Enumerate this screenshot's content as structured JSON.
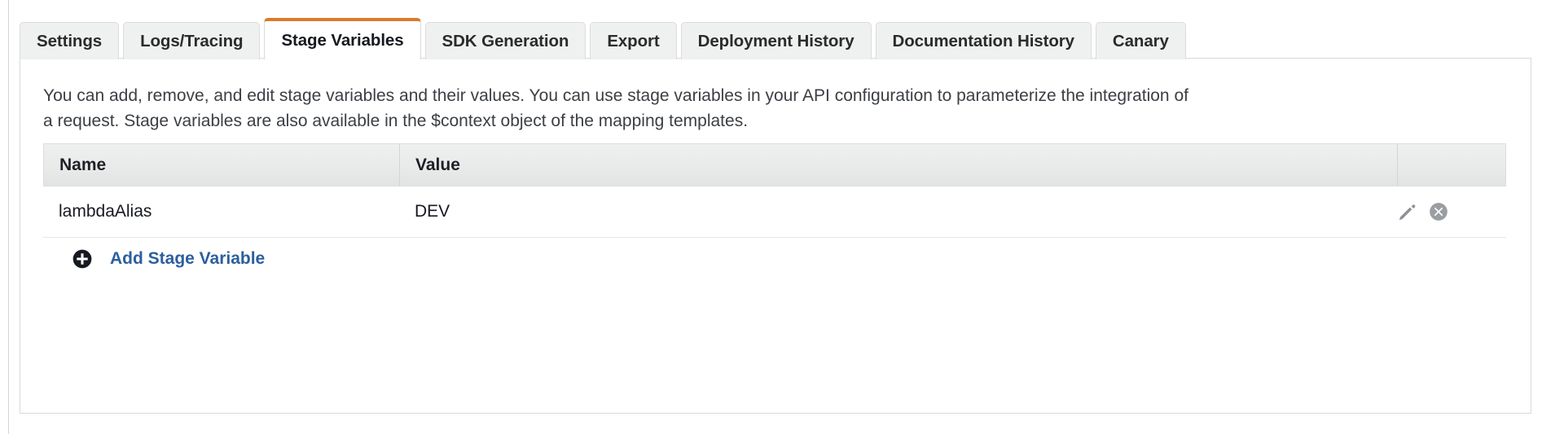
{
  "tabs": [
    {
      "label": "Settings",
      "active": false
    },
    {
      "label": "Logs/Tracing",
      "active": false
    },
    {
      "label": "Stage Variables",
      "active": true
    },
    {
      "label": "SDK Generation",
      "active": false
    },
    {
      "label": "Export",
      "active": false
    },
    {
      "label": "Deployment History",
      "active": false
    },
    {
      "label": "Documentation History",
      "active": false
    },
    {
      "label": "Canary",
      "active": false
    }
  ],
  "panel": {
    "description": "You can add, remove, and edit stage variables and their values. You can use stage variables in your API configuration to parameterize the integration of a request. Stage variables are also available in the $context object of the mapping templates."
  },
  "table": {
    "columns": [
      "Name",
      "Value",
      ""
    ],
    "rows": [
      {
        "name": "lambdaAlias",
        "value": "DEV",
        "edit_icon": "pencil-icon",
        "delete_icon": "delete-circle-icon"
      }
    ]
  },
  "add_variable": {
    "icon": "plus-circle-icon",
    "label": "Add Stage Variable"
  },
  "colors": {
    "active_tab_accent": "#d97b29",
    "link": "#2c5f9e",
    "tab_inactive_bg": "#eff0f0",
    "table_header_bg": "#e9eaea"
  }
}
